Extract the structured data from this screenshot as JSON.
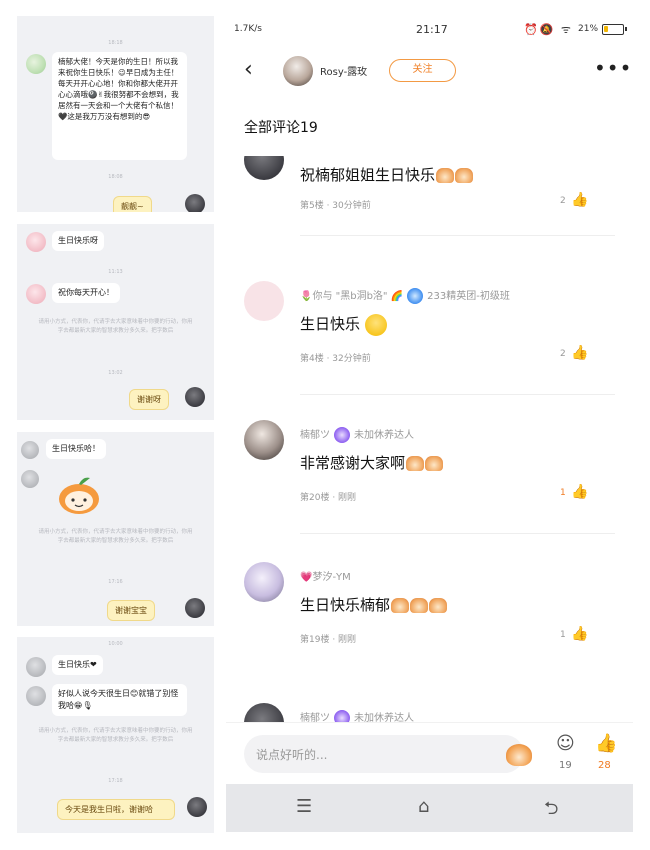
{
  "left_panels": [
    {
      "top_time": "18:18",
      "message": "楠郁大佬！今天是你的生日！所以我来祝你生日快乐！😉早日成为主任！\n每天开开心心地！你和你都大佬开开心心滴哦🎱✌我很努都不会想到，我居然有一天会和一个大佬有个私信！🖤这是我万万没有想到的😎",
      "mid_time": "18:08",
      "reply": "靓靓~"
    },
    {
      "message1": "生日快乐呀",
      "mid_time": "11:13",
      "message2": "祝你每天开心！",
      "system": "请用小方式，代表你，代请字去大家意味着中你要的行动，你用字去都最新大家的智慧求教分多久来。把字数后",
      "time2": "13:02",
      "reply": "谢谢呀"
    },
    {
      "message1": "生日快乐哈！",
      "system": "请用小方式，代表你，代请字去大家意味着中你要的行动，你用字去都最新大家的智慧求教分多久来。把字数后",
      "time2": "17:16",
      "reply": "谢谢宝宝"
    },
    {
      "top_time": "10:00",
      "message1": "生日快乐❤",
      "message2": "好似人说今天很生日😊就错了别怪我哈😁🎙",
      "system": "请用小方式，代表你，代请字去大家意味着中你要的行动，你用字去都最新大家的智慧求教分多久来。把字数后",
      "time2": "17:18",
      "reply": "今天是我生日啦，谢谢哈"
    }
  ],
  "status_bar": {
    "net_speed": "1.7K/s",
    "time": "21:17",
    "icons": "⏰🔕 ᯤ",
    "battery_pct": "21%",
    "battery_level": 0.21
  },
  "header": {
    "back_icon": "‹",
    "user_name": "Rosy-露玫",
    "follow_label": "关注",
    "more_icon": "•••"
  },
  "comments_heading": "全部评论19",
  "comments": [
    {
      "author": "...",
      "badge": "",
      "text": "祝楠郁姐姐生日快乐",
      "floor": "第5楼 · 30分钟前",
      "likes": "2",
      "liked": false
    },
    {
      "author": "🌷你与 \"黑b洞b洛\" 🌈",
      "badge": "233精英团-初级班",
      "text": "生日快乐",
      "floor": "第4楼 · 32分钟前",
      "likes": "2",
      "liked": false
    },
    {
      "author": "楠郁ツ",
      "badge": "未加休养达人",
      "text": "非常感谢大家啊",
      "floor": "第20楼 · 刚刚",
      "likes": "1",
      "liked": true
    },
    {
      "author": "💗梦汐-YM",
      "badge": "",
      "text": "生日快乐楠郁",
      "floor": "第19楼 · 刚刚",
      "likes": "1",
      "liked": false
    },
    {
      "author": "楠郁ツ",
      "badge": "未加休养达人",
      "text": "",
      "floor": "",
      "likes": "",
      "liked": false
    }
  ],
  "input_bar": {
    "placeholder": "说点好听的...",
    "comment_count": "19",
    "like_count": "28"
  },
  "colors": {
    "accent": "#f07b23",
    "panel_bg": "#f0f1f4",
    "yellow_bubble": "#fdf2c0"
  }
}
